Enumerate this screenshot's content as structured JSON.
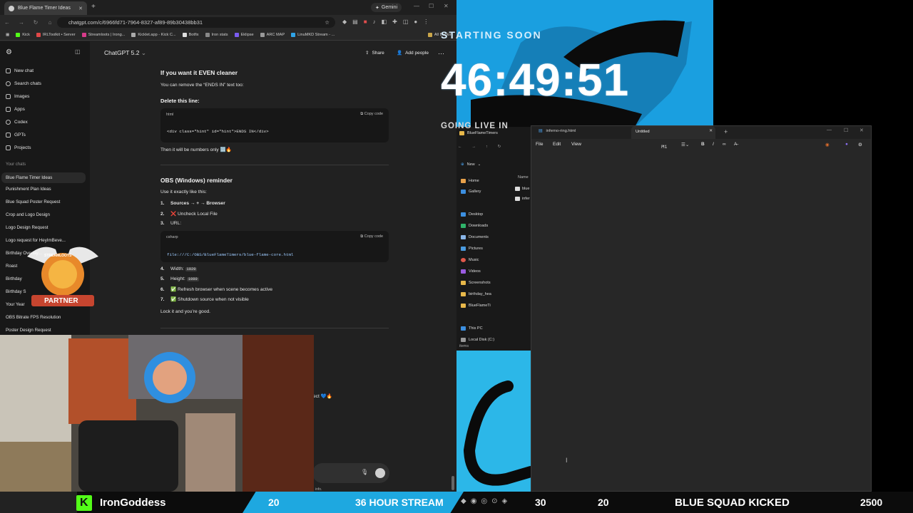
{
  "browser": {
    "tab_title": "Blue Flame Timer Ideas",
    "gemini_label": "Gemini",
    "url": "chatgpt.com/c/6966fd71-7964-8327-af89-89b30438bb31",
    "bookmarks": [
      "Kick",
      "IRLToolkit • Server",
      "Streamloots | Irong...",
      "Kicklet.app - Kick C...",
      "Botfix",
      "Iron stats",
      "Eklipse",
      "ARC MAP",
      "LinuMKD Stream - ..."
    ],
    "all_bookmarks": "All Bookm"
  },
  "sidebar": {
    "items": [
      "New chat",
      "Search chats",
      "Images",
      "Apps",
      "Codex",
      "GPTs",
      "Projects"
    ],
    "section": "Your chats",
    "chats": [
      "Blue Flame Timer Ideas",
      "Punishment Plan Ideas",
      "Blue Squad Poster Request",
      "Crop and Logo Design",
      "Logo Design Request",
      "Logo request for HeyImBeve...",
      "Birthday Overlay...",
      "Roast",
      "Birthday",
      "Birthday S",
      "Your Year",
      "OBS Bitrate FPS Resolution",
      "Poster Design Request"
    ]
  },
  "header": {
    "model": "ChatGPT 5.2",
    "share": "Share",
    "add_people": "Add people"
  },
  "content": {
    "h_cleaner": "If you want it EVEN cleaner",
    "p_remove": "You can remove the “ENDS IN” text too:",
    "h_delete": "Delete this line:",
    "code1_lang": "html",
    "copy_code": "Copy code",
    "code1": "<div class=\"hint\" id=\"hint\">ENDS IN</div>",
    "p_numbers": "Then it will be numbers only 🔢🔥",
    "h_obs": "OBS (Windows) reminder",
    "p_use": "Use it exactly like this:",
    "steps": [
      "Sources → + → Browser",
      "❌ Uncheck Local File",
      "URL:"
    ],
    "code2_lang": "csharp",
    "code2": "file:///C:/OBS/BlueFlameTimers/blue-flame-core.html",
    "steps2": [
      "Width: ",
      "Height: ",
      "✅ Refresh browser when scene becomes active",
      "✅ Shutdown source when not visible"
    ],
    "width_val": "1920",
    "height_val": "1080",
    "p_lock": "Lock it and you’re good.",
    "partial_text": "ect 💙🔥",
    "partial_info": "info."
  },
  "overlay": {
    "starting": "STARTING SOON",
    "timer": "46:49:51",
    "going_live": "GOING LIVE IN"
  },
  "explorer": {
    "title": "BlueFlameTimers",
    "new_label": "New",
    "name_col": "Name",
    "nav": [
      "Home",
      "Gallery",
      "Desktop",
      "Downloads",
      "Documents",
      "Pictures",
      "Music",
      "Videos",
      "Screenshots",
      "birthday_hea",
      "BlueFlameTi",
      "This PC",
      "Local Disk (C:)"
    ],
    "files": [
      "blue",
      "infer"
    ],
    "status": "items"
  },
  "notepad": {
    "tab1": "inferno-ring.html",
    "tab2": "Untitled",
    "menu": [
      "File",
      "Edit",
      "View"
    ],
    "heading_tool": "H1"
  },
  "badge": {
    "top": "STREAMLOOTS",
    "label": "PARTNER"
  },
  "ticker": {
    "name": "IronGoddess",
    "n1": "20",
    "banner": "36 HOUR STREAM",
    "n2": "30",
    "n3": "20",
    "msg": "BLUE SQUAD KICKED",
    "n4": "2500"
  },
  "colors": {
    "overlay_blue": "#1a9fe0",
    "kick_green": "#53fc18",
    "ticker_blue": "#1ea8e0"
  }
}
